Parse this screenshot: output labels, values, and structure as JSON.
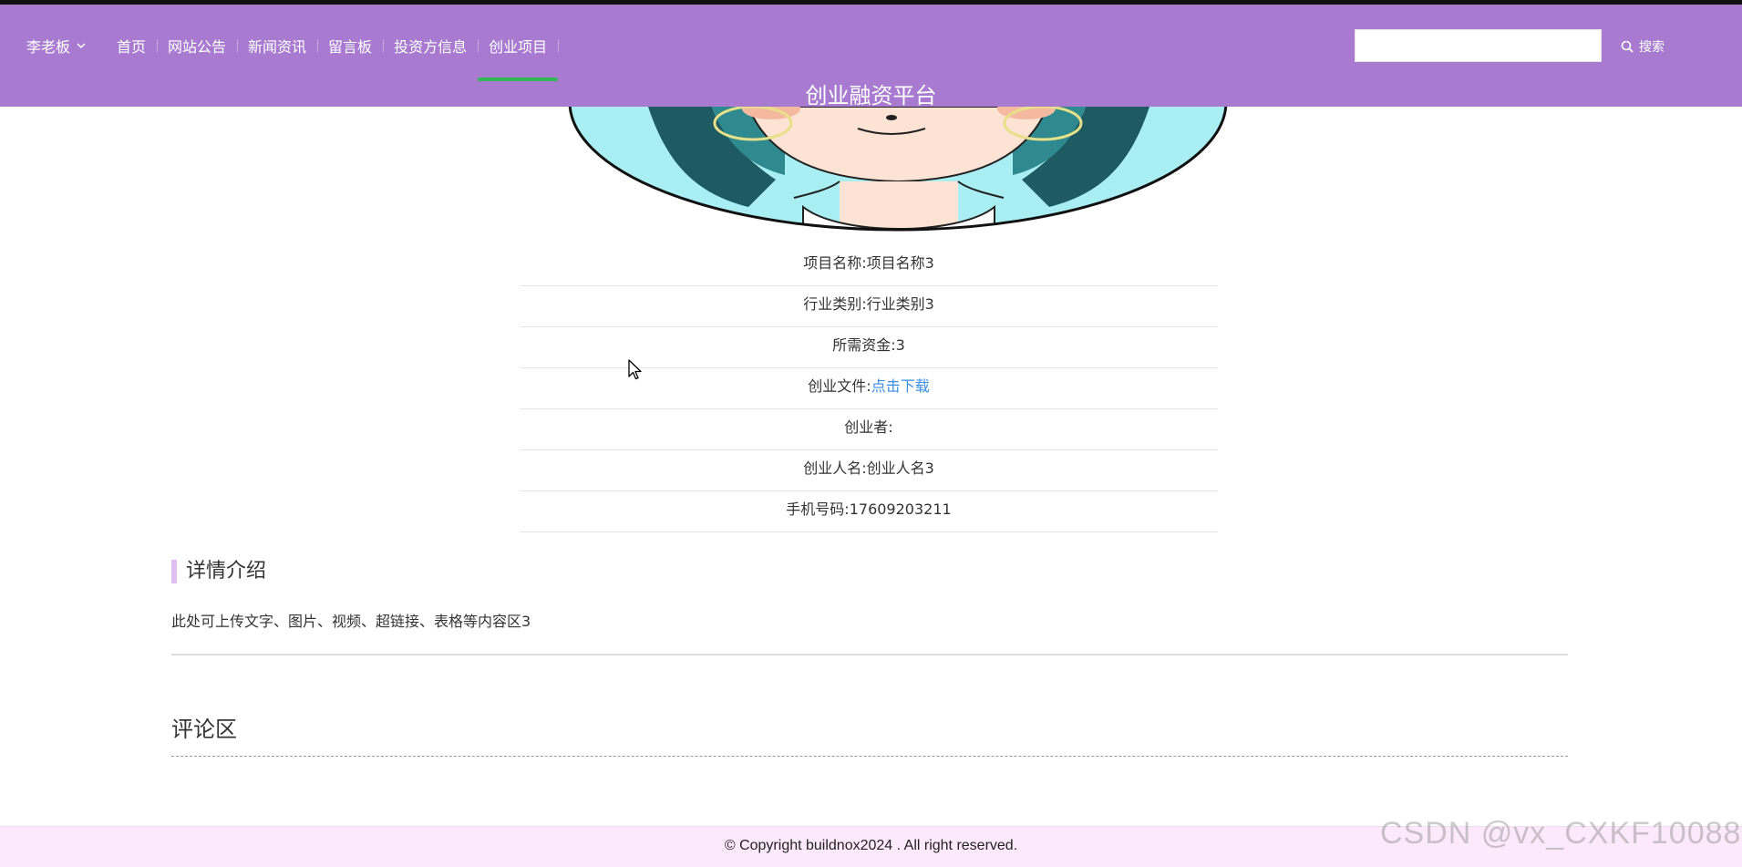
{
  "header": {
    "user_name": "李老板",
    "nav": [
      {
        "label": "首页",
        "active": false
      },
      {
        "label": "网站公告",
        "active": false
      },
      {
        "label": "新闻资讯",
        "active": false
      },
      {
        "label": "留言板",
        "active": false
      },
      {
        "label": "投资方信息",
        "active": false
      },
      {
        "label": "创业项目",
        "active": true
      }
    ],
    "search": {
      "placeholder": "",
      "button_label": "搜索"
    },
    "site_title": "创业融资平台"
  },
  "project": {
    "image": "avatar-illustration",
    "fields": [
      {
        "label": "项目名称:",
        "value": "项目名称3"
      },
      {
        "label": "行业类别:",
        "value": "行业类别3"
      },
      {
        "label": "所需资金:",
        "value": "3"
      },
      {
        "label": "创业文件:",
        "value": "",
        "link": "点击下载"
      },
      {
        "label": "创业者:",
        "value": ""
      },
      {
        "label": "创业人名:",
        "value": "创业人名3"
      },
      {
        "label": "手机号码:",
        "value": "17609203211"
      }
    ]
  },
  "detail": {
    "title": "详情介绍",
    "text": "此处可上传文字、图片、视频、超链接、表格等内容区3"
  },
  "comments": {
    "title": "评论区"
  },
  "footer": {
    "copyright": "© Copyright buildnox2024 . All right reserved."
  },
  "watermark": "CSDN @vx_CXKF10088",
  "colors": {
    "header_bg": "#a87bd1",
    "nav_active_underline": "#2fb855",
    "link": "#3a8ee6",
    "footer_bg": "#fce9fb"
  }
}
